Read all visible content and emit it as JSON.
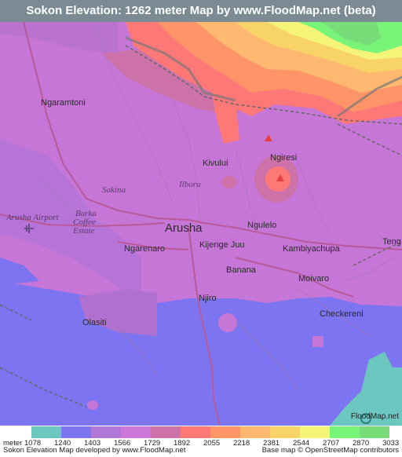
{
  "title": "Sokon Elevation: 1262 meter Map by www.FloodMap.net (beta)",
  "places": {
    "ngaramtoni": "Ngaramtoni",
    "kivului": "Kivului",
    "ngiresi": "Ngiresi",
    "ilboru": "Ilboru",
    "sakina": "Sakina",
    "arusha_airport": "Arusha Airport",
    "burka_1": "Burka",
    "burka_2": "Coffee",
    "burka_3": "Estate",
    "arusha": "Arusha",
    "ngulelo": "Ngulelo",
    "tengeru": "Teng",
    "ngarenaro": "Ngarenaro",
    "kijenge_juu": "Kijenge Juu",
    "kambiyachupa": "Kambiyachupa",
    "banana": "Banana",
    "moivaro": "Moivaro",
    "njiro": "Njiro",
    "olasiti": "Olasiti",
    "checkereni": "Checkereni"
  },
  "watermark": "FloodMap.net",
  "legend": {
    "unit_label": "meter",
    "values": [
      "1078",
      "1240",
      "1403",
      "1566",
      "1729",
      "1892",
      "2055",
      "2218",
      "2381",
      "2544",
      "2707",
      "2870",
      "3033"
    ],
    "colors": [
      "#6cc7c0",
      "#7c74f0",
      "#b076d8",
      "#cc78d8",
      "#cc72a8",
      "#ff7878",
      "#ff9468",
      "#ffb870",
      "#f8d468",
      "#f4f478",
      "#78f478",
      "#78dc78"
    ]
  },
  "footer": {
    "left": "Sokon Elevation Map developed by www.FloodMap.net",
    "right": "Base map © OpenStreetMap contributors"
  }
}
